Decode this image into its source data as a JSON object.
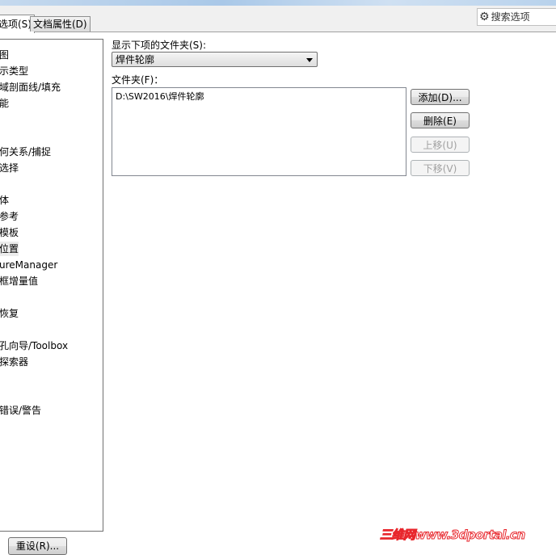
{
  "tabs": [
    {
      "label": "选项(S)",
      "active": true
    },
    {
      "label": "文档属性(D)",
      "active": false
    }
  ],
  "search": {
    "icon": "gear-icon",
    "placeholder": "搜索选项"
  },
  "sidebar": {
    "items": [
      "",
      "图",
      "示类型",
      "域剖面线/填充",
      "能",
      "",
      "",
      "何关系/捕捉",
      "选择",
      "",
      "体",
      "参考",
      "模板",
      "位置",
      "ureManager",
      "框增量值",
      "",
      "恢复",
      "",
      "孔向导/Toolbox",
      "探索器",
      "",
      "",
      "错误/警告"
    ],
    "selected_index": 13
  },
  "main": {
    "show_folders_label": "显示下项的文件夹(S):",
    "folder_type_value": "焊件轮廓",
    "folders_label": "文件夹(F)：",
    "folders": [
      "D:\\SW2016\\焊件轮廓"
    ],
    "buttons": {
      "add": "添加(D)...",
      "delete": "删除(E)",
      "move_up": "上移(U)",
      "move_down": "下移(V)"
    }
  },
  "footer": {
    "reset": "重设(R)..."
  },
  "watermark": "三维网www.3dportal.cn"
}
